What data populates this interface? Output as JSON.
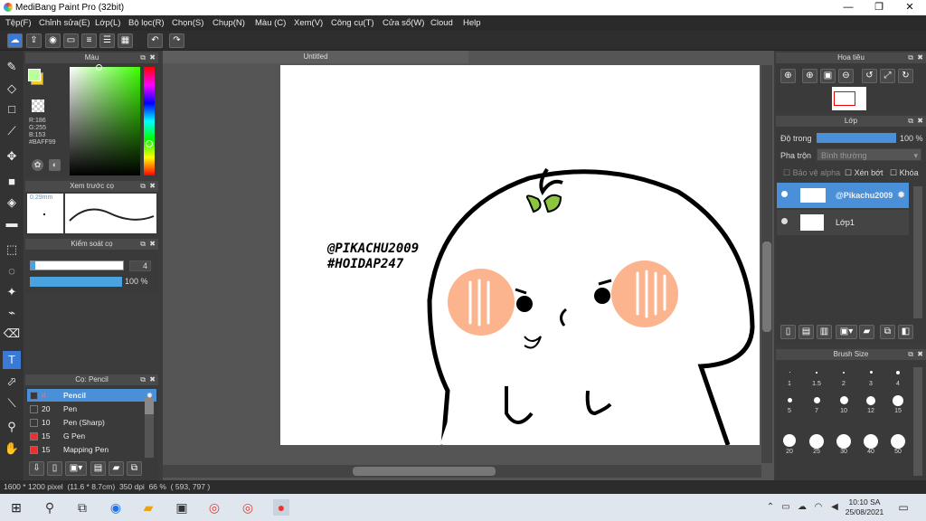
{
  "window": {
    "title": "MediBang Paint Pro (32bit)"
  },
  "menu": [
    "Tệp(F)",
    "Chỉnh sửa(E)",
    "Lớp(L)",
    "Bộ lọc(R)",
    "Chọn(S)",
    "Chụp(N)",
    "Màu (C)",
    "Xem(V)",
    "Công cụ(T)",
    "Cửa sổ(W)",
    "Cloud",
    "Help"
  ],
  "color_panel": {
    "title": "Màu",
    "r": "R:186",
    "g": "G:255",
    "b": "B:153",
    "hex": "#BAFF99",
    "fg_color": "#baff99",
    "bg_color": "#f7c82f"
  },
  "brush_preview": {
    "title": "Xem trước cọ",
    "size": "0.29mm"
  },
  "brush_control": {
    "title": "Kiểm soát cọ",
    "size_value": "4",
    "opacity_value": "100 %"
  },
  "brushes": {
    "title": "Cọ: Pencil",
    "items": [
      {
        "size": "4",
        "name": "Pencil",
        "color": "#3a3a3a"
      },
      {
        "size": "20",
        "name": "Pen",
        "color": "#3a3a3a"
      },
      {
        "size": "10",
        "name": "Pen (Sharp)",
        "color": "#3a3a3a"
      },
      {
        "size": "15",
        "name": "G Pen",
        "color": "#e83030"
      },
      {
        "size": "15",
        "name": "Mapping Pen",
        "color": "#e83030"
      }
    ]
  },
  "canvas": {
    "tab": "Untitled",
    "text_line1": "@PIKACHU2009",
    "text_line2": "#HOIDAP247"
  },
  "navigator": {
    "title": "Hoa tiêu"
  },
  "layers": {
    "title": "Lớp",
    "opacity_label": "Độ trong",
    "opacity_value": "100 %",
    "blend_label": "Pha trộn",
    "blend_value": "Bình thường",
    "protect_alpha": "Bảo vệ alpha",
    "clipping": "Xén bớt",
    "lock": "Khóa",
    "items": [
      {
        "name": "@Pikachu2009"
      },
      {
        "name": "Lớp1"
      }
    ]
  },
  "brush_size": {
    "title": "Brush Size",
    "sizes": [
      "1",
      "1.5",
      "2",
      "3",
      "4",
      "5",
      "7",
      "10",
      "12",
      "15",
      "20",
      "25",
      "30",
      "40",
      "50"
    ]
  },
  "status": {
    "dims": "1600 * 1200 pixel",
    "physical": "(11.6 * 8.7cm)",
    "dpi": "350 dpi",
    "zoom": "66 %",
    "coords": "( 593, 797 )"
  },
  "taskbar": {
    "time": "10:10 SA",
    "date": "25/08/2021"
  }
}
